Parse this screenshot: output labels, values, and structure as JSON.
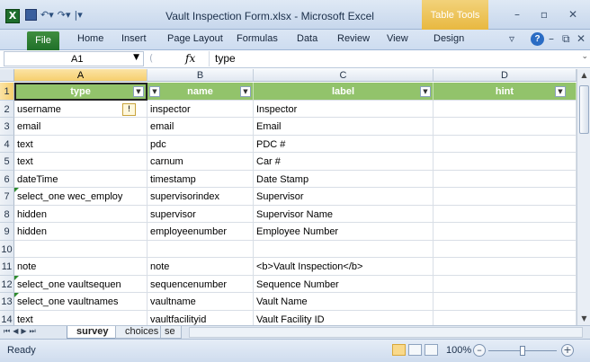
{
  "window": {
    "title": "Vault Inspection Form.xlsx  -  Microsoft Excel",
    "context_tab": "Table Tools",
    "app_icon": "X"
  },
  "ribbon": {
    "file": "File",
    "tabs": [
      "Home",
      "Insert",
      "Page Layout",
      "Formulas",
      "Data",
      "Review",
      "View",
      "Design"
    ]
  },
  "formula_bar": {
    "name_box": "A1",
    "fx_label": "fx",
    "value": "type"
  },
  "columns": [
    "A",
    "B",
    "C",
    "D"
  ],
  "table": {
    "headers": [
      "type",
      "name",
      "label",
      "hint"
    ],
    "rows": [
      {
        "num": "2",
        "cells": [
          "username",
          "inspector",
          "Inspector",
          ""
        ]
      },
      {
        "num": "3",
        "cells": [
          "email",
          "email",
          "Email",
          ""
        ]
      },
      {
        "num": "4",
        "cells": [
          "text",
          "pdc",
          "PDC #",
          ""
        ]
      },
      {
        "num": "5",
        "cells": [
          "text",
          "carnum",
          "Car #",
          ""
        ]
      },
      {
        "num": "6",
        "cells": [
          "dateTime",
          "timestamp",
          "Date Stamp",
          ""
        ]
      },
      {
        "num": "7",
        "cells": [
          "select_one wec_employ",
          "supervisorindex",
          "Supervisor",
          ""
        ]
      },
      {
        "num": "8",
        "cells": [
          "hidden",
          "supervisor",
          "Supervisor Name",
          ""
        ]
      },
      {
        "num": "9",
        "cells": [
          "hidden",
          "employeenumber",
          "Employee Number",
          ""
        ]
      },
      {
        "num": "10",
        "cells": [
          "",
          "",
          "",
          ""
        ]
      },
      {
        "num": "11",
        "cells": [
          "note",
          "note",
          "<b>Vault Inspection</b>",
          ""
        ]
      },
      {
        "num": "12",
        "cells": [
          "select_one vaultsequen",
          "sequencenumber",
          "Sequence Number",
          ""
        ]
      },
      {
        "num": "13",
        "cells": [
          "select_one vaultnames",
          "vaultname",
          "Vault Name",
          ""
        ]
      },
      {
        "num": "14",
        "cells": [
          "text",
          "vaultfacilityid",
          "Vault Facility ID",
          ""
        ]
      }
    ],
    "header_row_num": "1"
  },
  "sheets": {
    "active": "survey",
    "others": [
      "choices",
      "se"
    ]
  },
  "status": {
    "ready": "Ready",
    "zoom": "100%"
  },
  "colors": {
    "header_green": "#92c36b",
    "file_tab_green": "#20702a",
    "table_tools_gold": "#e8b840"
  }
}
